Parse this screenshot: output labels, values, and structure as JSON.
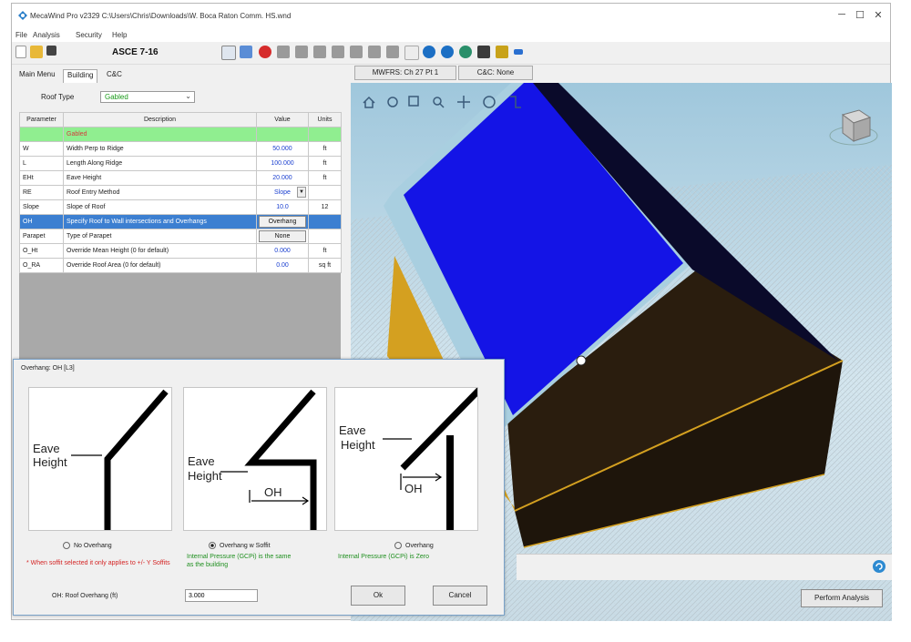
{
  "window": {
    "title": "MecaWind Pro v2329 C:\\Users\\Chris\\Downloads\\W. Boca Raton Comm. HS.wnd",
    "minimize": "─",
    "maximize": "☐",
    "close": "✕"
  },
  "menu": {
    "file": "File",
    "analysis": "Analysis",
    "security": "Security",
    "help": "Help"
  },
  "toolbar": {
    "standard": "ASCE 7-16"
  },
  "left_tabs": {
    "main_menu": "Main Menu",
    "building": "Building",
    "cc": "C&C"
  },
  "roof_type": {
    "label": "Roof Type",
    "value": "Gabled"
  },
  "table": {
    "headers": [
      "Parameter",
      "Description",
      "Value",
      "Units"
    ],
    "section": "Gabled",
    "rows": [
      {
        "param": "W",
        "desc": "Width Perp to Ridge",
        "value": "50.000",
        "units": "ft"
      },
      {
        "param": "L",
        "desc": "Length Along Ridge",
        "value": "100.000",
        "units": "ft"
      },
      {
        "param": "EHt",
        "desc": "Eave Height",
        "value": "20.000",
        "units": "ft"
      },
      {
        "param": "RE",
        "desc": "Roof Entry Method",
        "value": "Slope",
        "units": ""
      },
      {
        "param": "Slope",
        "desc": "Slope of Roof",
        "value": "10.0",
        "units": "12"
      },
      {
        "param": "OH",
        "desc": "Specify Roof to Wall intersections and Overhangs",
        "value": "Overhang",
        "units": ""
      },
      {
        "param": "Parapet",
        "desc": "Type of Parapet",
        "value": "None",
        "units": ""
      },
      {
        "param": "O_Ht",
        "desc": "Override Mean Height (0 for default)",
        "value": "0.000",
        "units": "ft"
      },
      {
        "param": "O_RA",
        "desc": "Override Roof Area (0 for default)",
        "value": "0.00",
        "units": "sq ft"
      }
    ]
  },
  "viewport_tabs": {
    "mwfrs": "MWFRS: Ch 27 Pt 1",
    "cc": "C&C: None"
  },
  "dialog": {
    "title": "Overhang: OH [L3]",
    "diagram_labels": {
      "eave": "Eave",
      "height": "Height",
      "oh": "OH"
    },
    "options": [
      {
        "label": "No Overhang",
        "selected": false
      },
      {
        "label": "Overhang w Soffit",
        "selected": true
      },
      {
        "label": "Overhang",
        "selected": false
      }
    ],
    "note_red": "* When soffit selected it only applies to +/- Y Soffits",
    "note_green_1a": "Internal Pressure (GCPi) is the same",
    "note_green_1b": "as the building",
    "note_green_2": "Internal Pressure (GCPi) is Zero",
    "oh_label": "OH: Roof Overhang (ft)",
    "oh_value": "3.000",
    "ok": "Ok",
    "cancel": "Cancel"
  },
  "perform_analysis": "Perform Analysis",
  "colors": {
    "roof_blue": "#1414e6",
    "wall_dark": "#2a1d0e",
    "edge_gold": "#d4a020",
    "trim_light": "#a9cfe0",
    "selected_row": "#3c7fd1",
    "section_green": "#90ee90"
  }
}
